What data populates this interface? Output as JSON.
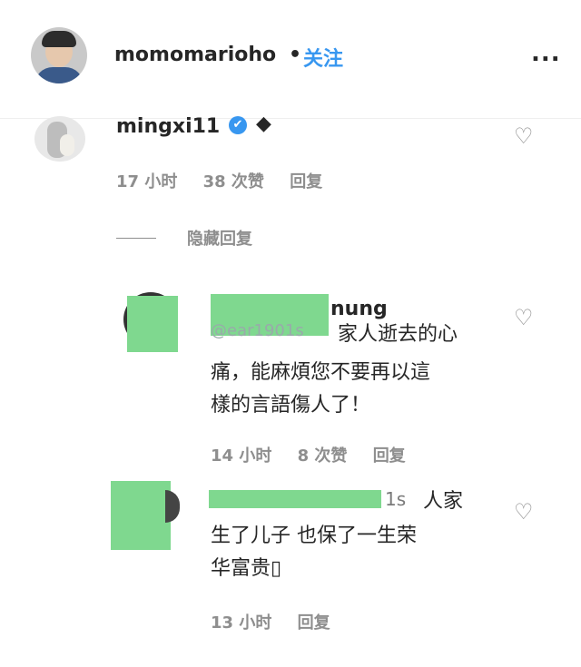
{
  "post_header": {
    "username": "momomarioho",
    "separator": "•",
    "follow_label": "关注",
    "more_label": "..."
  },
  "comments": [
    {
      "username": "mingxi11",
      "badge": "✔",
      "badge_extra": "◆",
      "time": "17 小时",
      "likes": "38 次赞",
      "reply_label": "回复",
      "hide_replies_label": "隐藏回复"
    }
  ],
  "replies": [
    {
      "username_tail": "nung",
      "mention_tail": "@ear1901s",
      "lines": [
        "家人逝去的心",
        "痛，能麻煩您不要再以這",
        "樣的言語傷人了！"
      ],
      "time": "14 小时",
      "likes": "8 次赞",
      "reply_label": "回复"
    },
    {
      "username_tail": "1s",
      "lines": [
        "人家",
        "生了儿子 也保了一生荣",
        "华富贵▯"
      ],
      "time": "13 小时",
      "reply_label": "回复"
    }
  ],
  "icons": {
    "heart": "heart-icon",
    "verified": "verified-icon"
  },
  "colors": {
    "link": "#3897f0",
    "meta": "#8e8e8e",
    "mask": "#7fd88f"
  }
}
